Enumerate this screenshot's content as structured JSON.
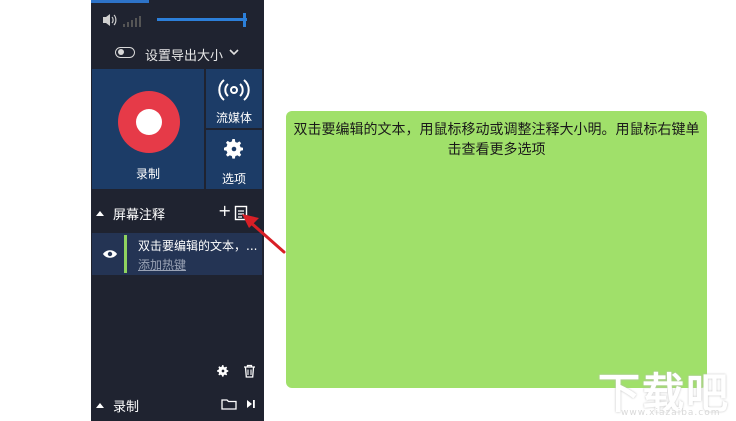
{
  "export": {
    "label": "设置导出大小"
  },
  "actions": {
    "record_label": "录制",
    "stream_label": "流媒体",
    "options_label": "选项"
  },
  "annotations": {
    "title": "屏幕注释",
    "items": [
      {
        "text": "双击要编辑的文本，...",
        "hotkey_link": "添加热键"
      }
    ]
  },
  "recording_section": {
    "title": "录制"
  },
  "note": {
    "text": "双击要编辑的文本，用鼠标移动或调整注释大小明。用鼠标右键单击查看更多选项"
  },
  "watermark": {
    "text": "下载吧",
    "url": "www.xiazaiba.com"
  },
  "colors": {
    "panel": "#1f2330",
    "accent_blue": "#2c7fd9",
    "record_red": "#e63a48",
    "note_green": "#a0e06a",
    "arrow_red": "#d81f26"
  }
}
